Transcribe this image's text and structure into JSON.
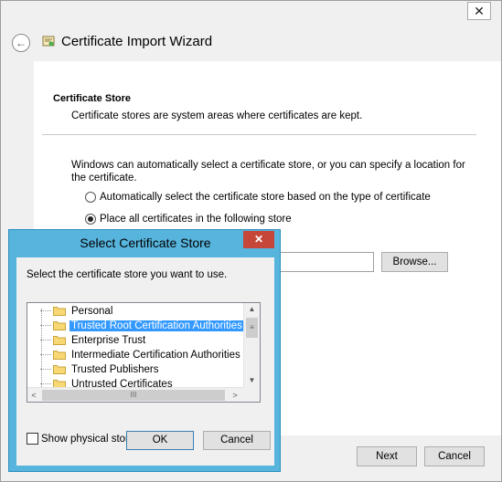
{
  "wizard": {
    "title": "Certificate Import Wizard",
    "close_glyph": "✕",
    "back_glyph": "←",
    "section": {
      "heading": "Certificate Store",
      "description": "Certificate stores are system areas where certificates are kept."
    },
    "intro": "Windows can automatically select a certificate store, or you can specify a location for the certificate.",
    "radio_auto_label": "Automatically select the certificate store based on the type of certificate",
    "radio_place_label": "Place all certificates in the following store",
    "radio_selected": "place",
    "store_value": "",
    "browse_label": "Browse...",
    "next_label": "Next",
    "cancel_label": "Cancel"
  },
  "dialog": {
    "title": "Select Certificate Store",
    "close_glyph": "✕",
    "prompt": "Select the certificate store you want to use.",
    "stores": [
      "Personal",
      "Trusted Root Certification Authorities",
      "Enterprise Trust",
      "Intermediate Certification Authorities",
      "Trusted Publishers",
      "Untrusted Certificates"
    ],
    "selected_store": "Trusted Root Certification Authorities",
    "show_physical_label": "Show physical stores",
    "show_physical_checked": false,
    "ok_label": "OK",
    "cancel_label": "Cancel"
  },
  "colors": {
    "dialog_frame": "#57b4dd",
    "close_button": "#c7463a",
    "selection": "#3399ff"
  }
}
